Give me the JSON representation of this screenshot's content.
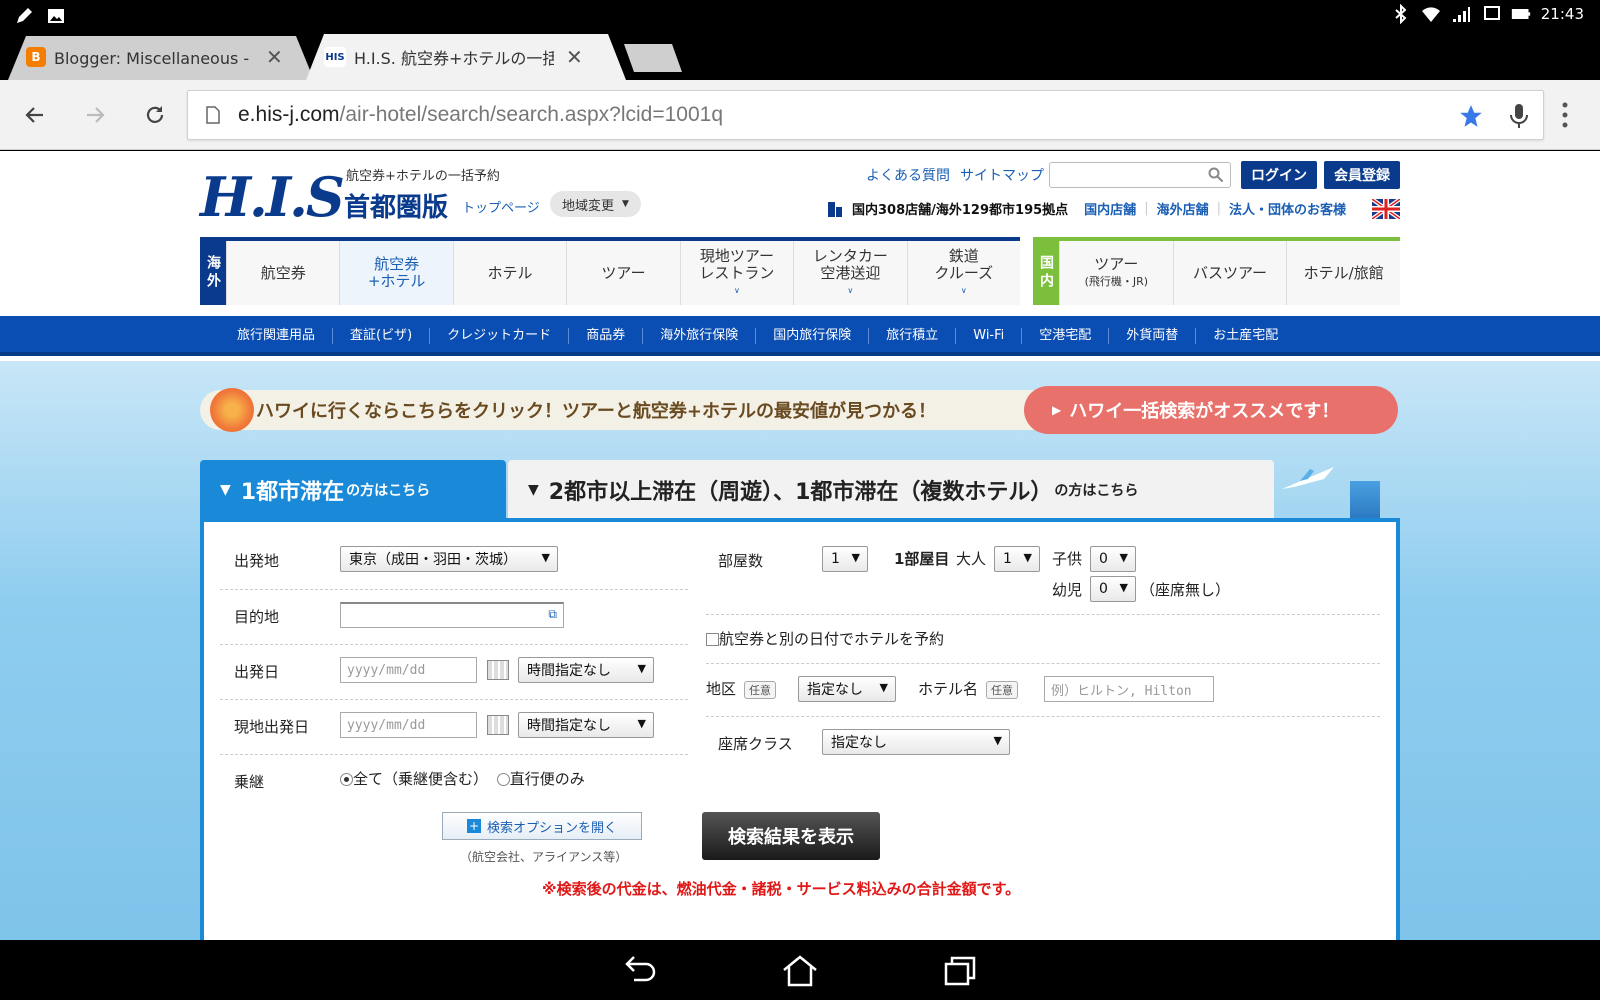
{
  "status_bar": {
    "time": "21:43"
  },
  "tabs": [
    {
      "title": "Blogger: Miscellaneous - す",
      "favicon": "B",
      "active": false
    },
    {
      "title": "H.I.S. 航空券+ホテルの一括",
      "favicon": "HIS",
      "active": true
    }
  ],
  "omnibox": {
    "host": "e.his-j.com",
    "path": "/air-hotel/search/search.aspx?lcid=1001q"
  },
  "header": {
    "logo": "H.I.S",
    "tagline": "航空券+ホテルの一括予約",
    "region": "首都圏版",
    "top_link": "トップページ",
    "area_button": "地域変更",
    "faq": "よくある質問",
    "sitemap": "サイトマップ",
    "login": "ログイン",
    "register": "会員登録",
    "store_count": "国内308店舗/海外129都市195拠点",
    "domestic_stores": "国内店舗",
    "overseas_stores": "海外店舗",
    "corporate": "法人・団体のお客様"
  },
  "nav_overseas": {
    "side": "海外",
    "items": [
      {
        "label": "航空券",
        "sub": ""
      },
      {
        "label": "航空券",
        "sub": "+ホテル"
      },
      {
        "label": "ホテル",
        "sub": ""
      },
      {
        "label": "ツアー",
        "sub": ""
      },
      {
        "label": "現地ツアー",
        "sub": "レストラン"
      },
      {
        "label": "レンタカー",
        "sub": "空港送迎"
      },
      {
        "label": "鉄道",
        "sub": "クルーズ"
      }
    ]
  },
  "nav_domestic": {
    "side": "国内",
    "items": [
      {
        "label": "ツアー",
        "sub": "(飛行機・JR)"
      },
      {
        "label": "バスツアー",
        "sub": ""
      },
      {
        "label": "ホテル/旅館",
        "sub": ""
      }
    ]
  },
  "subnav": [
    "旅行関連用品",
    "査証(ビザ)",
    "クレジットカード",
    "商品券",
    "海外旅行保険",
    "国内旅行保険",
    "旅行積立",
    "Wi-Fi",
    "空港宅配",
    "外貨両替",
    "お土産宅配"
  ],
  "banner": {
    "left": "ハワイに行くならこちらをクリック！ツアーと航空券+ホテルの最安値が見つかる！",
    "right": "ハワイ一括検索がオススメです！"
  },
  "search_tabs": {
    "tab1_main": "1都市滞在",
    "tab1_sub": "の方はこちら",
    "tab2_main": "2都市以上滞在（周遊）、1都市滞在（複数ホテル）",
    "tab2_sub": "の方はこちら"
  },
  "form": {
    "departure_label": "出発地",
    "departure_value": "東京（成田・羽田・茨城）",
    "destination_label": "目的地",
    "depart_date_label": "出発日",
    "date_placeholder": "yyyy/mm/dd",
    "time_value": "時間指定なし",
    "return_date_label": "現地出発日",
    "transfer_label": "乗継",
    "transfer_all": "全て（乗継便含む）",
    "transfer_direct": "直行便のみ",
    "rooms_label": "部屋数",
    "rooms_value": "1",
    "room1_label": "1部屋目",
    "adult_label": "大人",
    "adult_value": "1",
    "child_label": "子供",
    "child_value": "0",
    "infant_label": "幼児",
    "infant_value": "0",
    "infant_note": "（座席無し）",
    "separate_date": "航空券と別の日付でホテルを予約",
    "district_label": "地区",
    "optional_tag": "任意",
    "district_value": "指定なし",
    "hotel_label": "ホテル名",
    "hotel_placeholder": "例）ヒルトン, Hilton",
    "seat_label": "座席クラス",
    "seat_value": "指定なし",
    "options_button": "検索オプションを開く",
    "options_note": "（航空会社、アライアンス等）",
    "search_button": "検索結果を表示",
    "notice": "※検索後の代金は、燃油代金・諸税・サービス料込みの合計金額です。"
  }
}
